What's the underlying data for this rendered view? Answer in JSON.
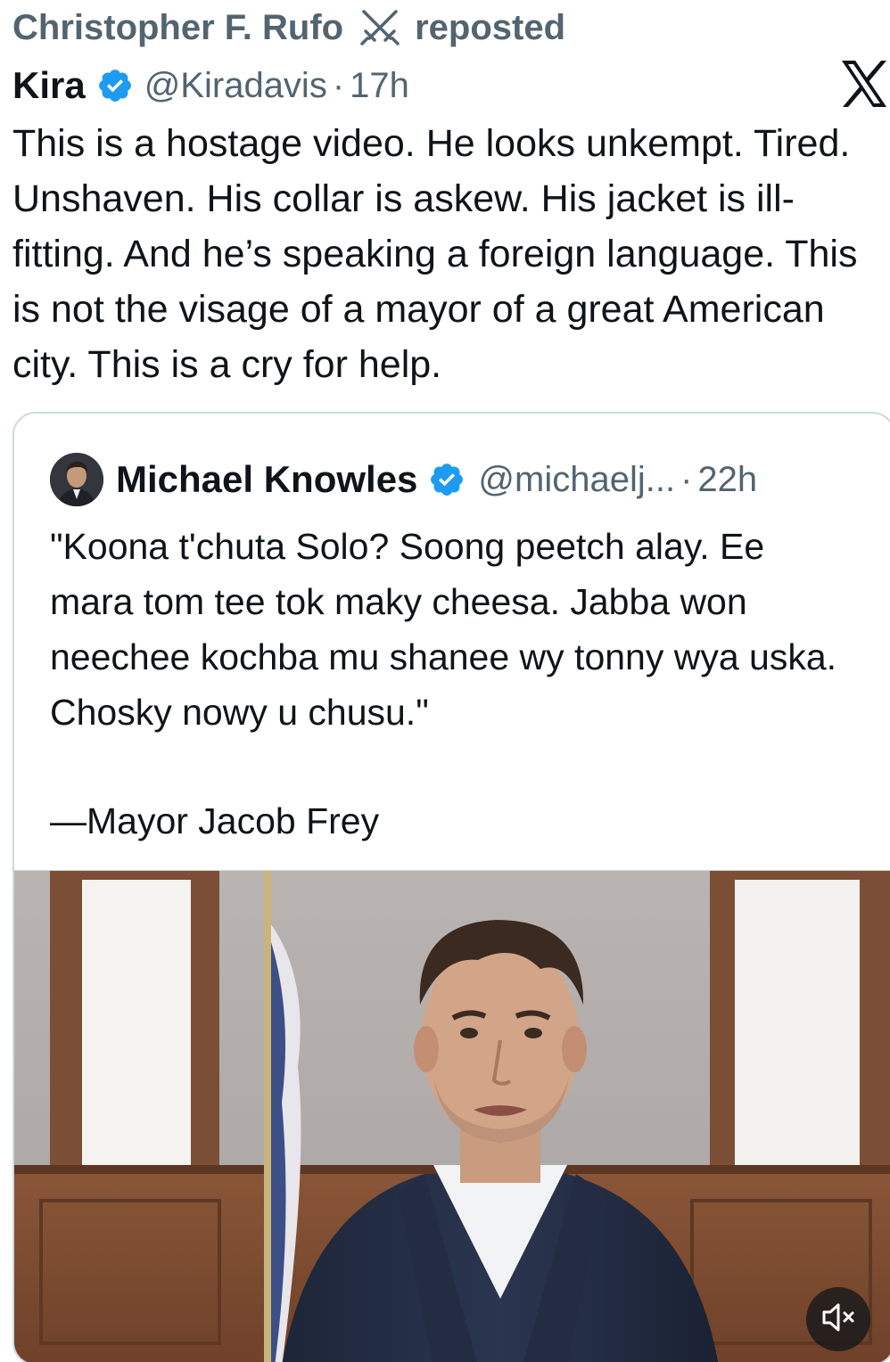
{
  "repost": {
    "name": "Christopher F. Rufo",
    "emoji_icon": "crossed-swords-icon",
    "suffix": "reposted"
  },
  "tweet": {
    "author_name": "Kira",
    "verified_icon": "verified-badge-icon",
    "handle": "@Kiradavis",
    "separator": "·",
    "time": "17h",
    "platform_icon": "x-logo-icon",
    "text": "This is a hostage video. He looks unkempt. Tired. Unshaven. His collar is askew. His jacket is ill-fitting. And he’s speaking a foreign language. This is not the visage of a mayor of a great American city. This is a cry for help."
  },
  "quote": {
    "author_name": "Michael Knowles",
    "verified_icon": "verified-badge-icon",
    "handle": "@michaelj...",
    "separator": "·",
    "time": "22h",
    "text": "\"Koona t'chuta Solo? Soong peetch alay. Ee mara tom tee tok maky cheesa. Jabba won neechee kochba mu shanee wy tonny wya uska. Chosky nowy u chusu.\"",
    "signature": "—Mayor Jacob Frey",
    "media_controls": {
      "mute_icon": "speaker-muted-icon"
    }
  },
  "colors": {
    "text_primary": "#0f1419",
    "text_secondary": "#536471",
    "verified_blue": "#1d9bf0",
    "border": "#cfd9de"
  }
}
